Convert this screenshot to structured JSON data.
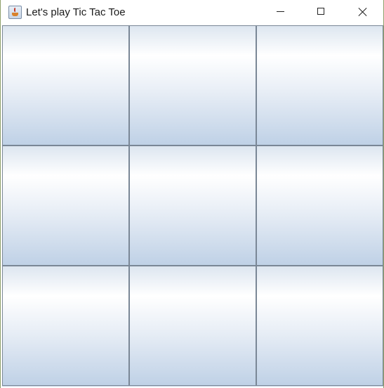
{
  "window": {
    "title": "Let's play Tic Tac Toe",
    "app_icon": "java-cup-icon"
  },
  "controls": {
    "minimize_icon": "minimize-icon",
    "maximize_icon": "maximize-icon",
    "close_icon": "close-icon"
  },
  "board": {
    "rows": 3,
    "cols": 3,
    "cells": [
      "",
      "",
      "",
      "",
      "",
      "",
      "",
      "",
      ""
    ]
  },
  "colors": {
    "cell_border": "#7a8796",
    "cell_gradient_light": "#ffffff",
    "cell_gradient_dark": "#bfd1e6"
  }
}
